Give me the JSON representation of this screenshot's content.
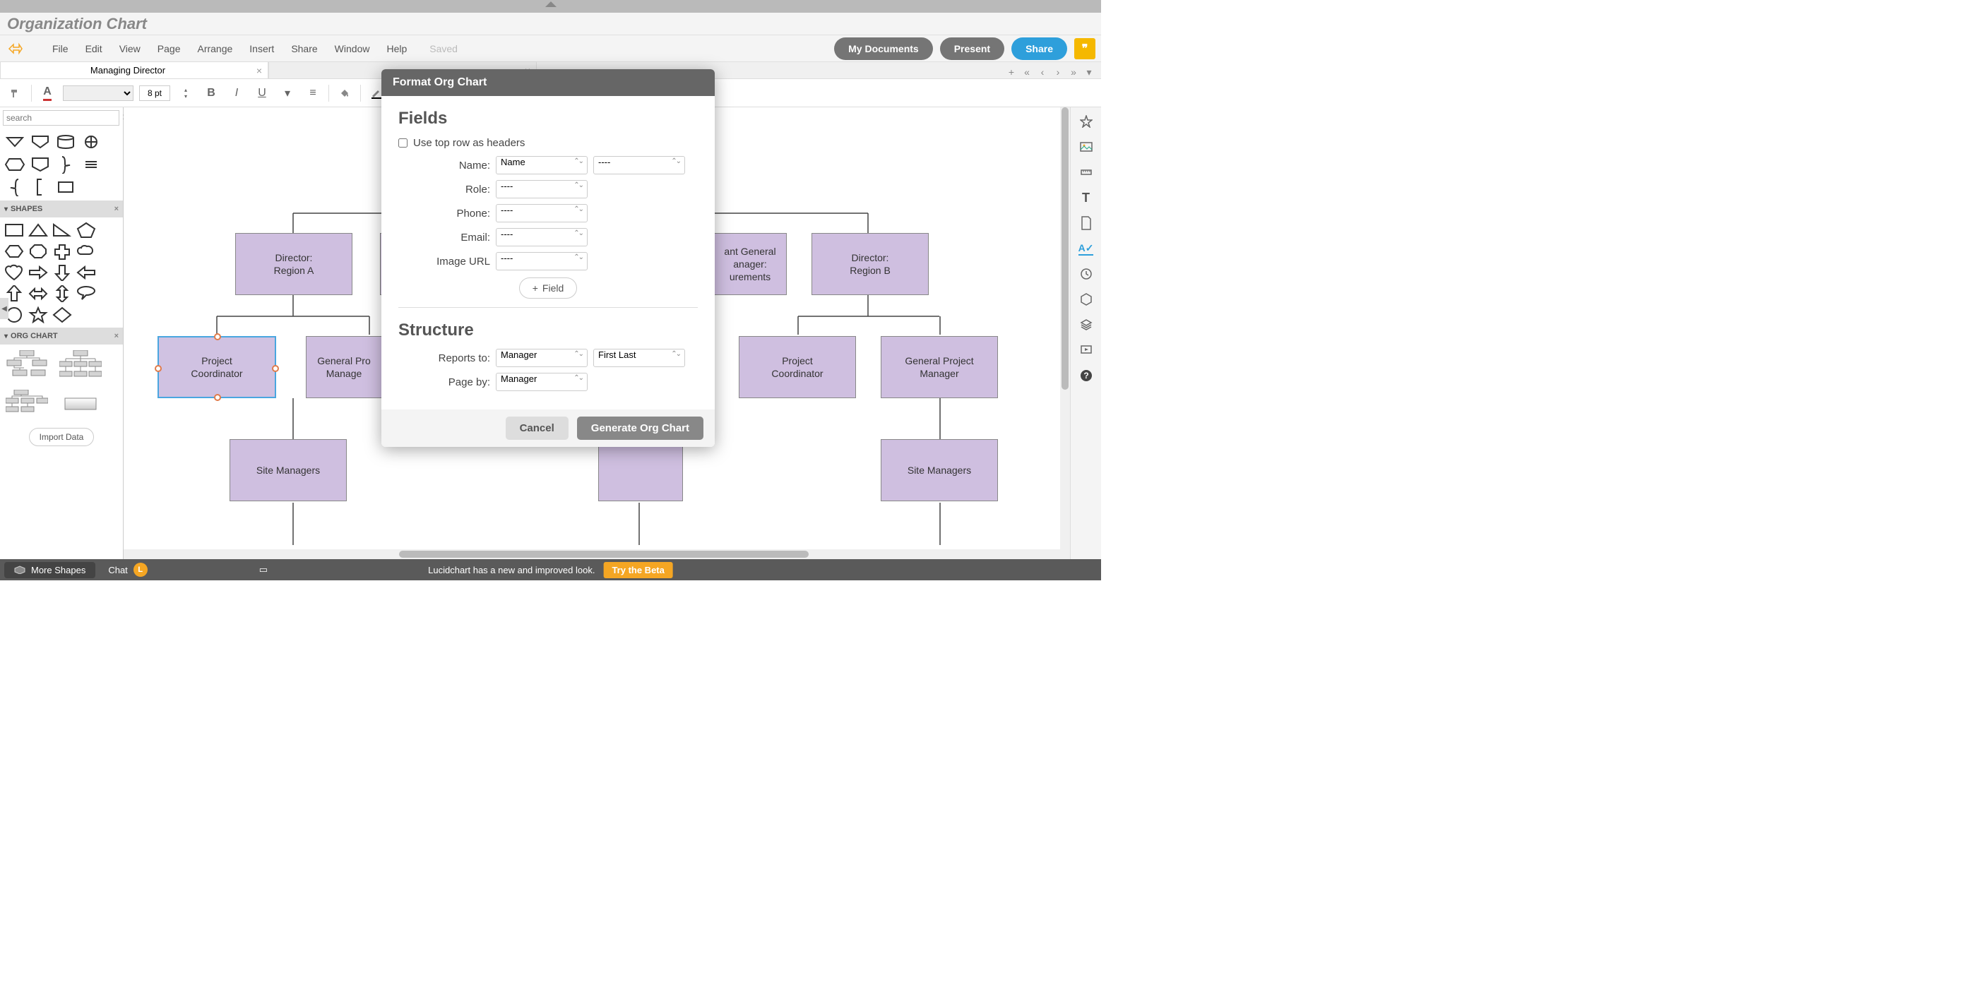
{
  "document": {
    "title": "Organization Chart",
    "saved_label": "Saved"
  },
  "menu": {
    "items": [
      "File",
      "Edit",
      "View",
      "Page",
      "Arrange",
      "Insert",
      "Share",
      "Window",
      "Help"
    ]
  },
  "menubar_right": {
    "my_docs": "My Documents",
    "present": "Present",
    "share": "Share"
  },
  "tabs": {
    "active": "Managing Director",
    "inactive": ""
  },
  "toolbar": {
    "font_size": "8 pt"
  },
  "sidebar": {
    "search_placeholder": "search",
    "shapes_header": "SHAPES",
    "orgchart_header": "ORG CHART",
    "import_data": "Import Data"
  },
  "canvas": {
    "nodes": {
      "dir_a": "Director:\nRegion A",
      "dir_b": "Director:\nRegion B",
      "asst_gm": "ant General\nanager:\nurements",
      "proj_coord_l": "Project\nCoordinator",
      "gpm_l": "General Pro\nManage",
      "proj_coord_r": "Project\nCoordinator",
      "gpm_r": "General Project\nManager",
      "site_mgr_l": "Site Managers",
      "site_mgr_r": "Site Managers"
    }
  },
  "dialog": {
    "title": "Format Org Chart",
    "fields_title": "Fields",
    "checkbox_label": "Use top row as headers",
    "name_label": "Name:",
    "role_label": "Role:",
    "phone_label": "Phone:",
    "email_label": "Email:",
    "image_label": "Image URL",
    "name_value": "Name",
    "dash_value": "----",
    "add_field": "Field",
    "structure_title": "Structure",
    "reports_label": "Reports to:",
    "pageby_label": "Page by:",
    "manager_value": "Manager",
    "firstlast_value": "First Last",
    "cancel": "Cancel",
    "generate": "Generate Org Chart"
  },
  "bottom": {
    "more_shapes": "More Shapes",
    "chat": "Chat",
    "avatar_letter": "L",
    "announcement": "Lucidchart has a new and improved look.",
    "try_beta": "Try the Beta"
  }
}
